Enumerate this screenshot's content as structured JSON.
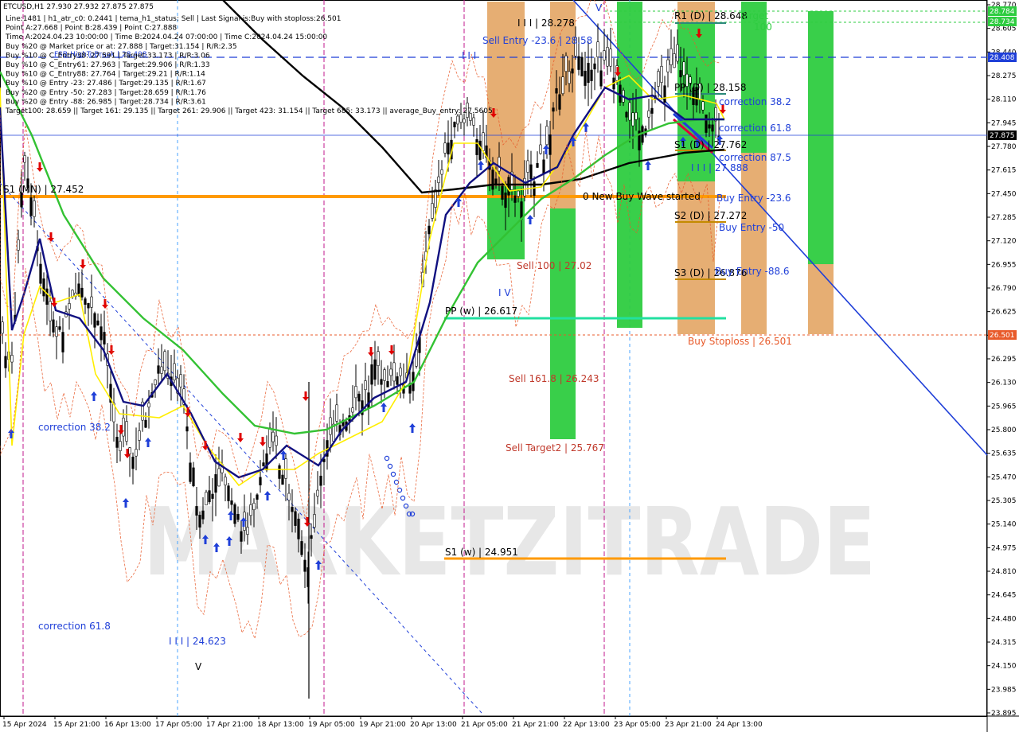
{
  "header": {
    "symbol_line": "ETCUSD,H1  27.930 27.932 27.875 27.875",
    "info_lines": [
      "Line:1481 | h1_atr_c0: 0.2441 | tema_h1_status: Sell | Last Signal is:Buy with stoploss:26.501",
      "Point A:27.668 | Point B:28.439 | Point C:27.888",
      "Time A:2024.04.23 10:00:00 | Time B:2024.04.24 07:00:00 | Time C:2024.04.24 15:00:00",
      "Buy %20 @ Market price or at: 27.888 | Target:31.154 | R/R:2.35",
      "Buy %10 @ C_Entry38: 27.591 | Target:33.173 | R/R:3.06",
      "Buy %10 @ C_Entry61: 27.963 | Target:29.906 | R/R:1.33",
      "Buy %10 @ C_Entry88: 27.764 | Target:29.21 | R/R:1.14",
      "Buy %10 @ Entry -23: 27.486 | Target:29.135 | R/R:1.67",
      "Buy %20 @ Entry -50: 27.283 | Target:28.659 | R/R:1.76",
      "Buy %20 @ Entry -88: 26.985 | Target:28.734 | R/R:3.61",
      "Target100: 28.659 || Target 161: 29.135 || Target 261: 29.906 || Target 423: 31.154 || Target 685: 33.173 || average_Buy_entry: 27.5605"
    ],
    "fsb_label": "FSB-HighToBreak | 28.408"
  },
  "price_axis": {
    "ticks": [
      "28.770",
      "28.605",
      "28.440",
      "28.275",
      "28.110",
      "27.945",
      "27.780",
      "27.615",
      "27.450",
      "27.285",
      "27.120",
      "26.955",
      "26.790",
      "26.625",
      "26.460",
      "26.295",
      "26.130",
      "25.965",
      "25.800",
      "25.635",
      "25.470",
      "25.305",
      "25.140",
      "24.975",
      "24.810",
      "24.645",
      "24.480",
      "24.315",
      "24.150",
      "23.985",
      "23.895"
    ],
    "tags": [
      {
        "text": "28.784",
        "color": "#2ecc40"
      },
      {
        "text": "28.734",
        "color": "#2ecc40"
      },
      {
        "text": "28.408",
        "color": "#1f3fd8"
      },
      {
        "text": "27.875",
        "color": "#000000"
      },
      {
        "text": "26.501",
        "color": "#e85a2a"
      }
    ]
  },
  "time_axis": {
    "labels": [
      "15 Apr 2024",
      "15 Apr 21:00",
      "16 Apr 13:00",
      "17 Apr 05:00",
      "17 Apr 21:00",
      "18 Apr 13:00",
      "19 Apr 05:00",
      "19 Apr 21:00",
      "20 Apr 13:00",
      "21 Apr 05:00",
      "21 Apr 21:00",
      "22 Apr 13:00",
      "23 Apr 05:00",
      "23 Apr 21:00",
      "24 Apr 13:00"
    ]
  },
  "annotations": {
    "III_28278": "I I I | 28.278",
    "sell_entry": "Sell Entry -23.6 | 28.58",
    "III_top": "I I I",
    "V_top": "V",
    "r1": "R1 (D) | 28.648",
    "target_label": "Target",
    "target_100": "100",
    "pp_d": "PP (D) | 28.158",
    "corr_382_right": "correction 38.2",
    "corr_618_right": "correction 61.8",
    "s1_d": "S1 (D) | 27.762",
    "corr_875": "correction 87.5",
    "III_27888": "I I I | 27.888",
    "s1_left": "S1 (MN) | 27.452",
    "new_wave": "0 New Buy Wave started",
    "buy_entry_236": "Buy Entry -23.6",
    "s2_d": "S2 (D) | 27.272",
    "buy_entry_50": "Buy Entry -50",
    "sell_100": "Sell 100 | 27.02",
    "s3_d": "S3 (D) | 26.876",
    "buy_entry_886": "Buy Entry -88.6",
    "IV_label": "I V",
    "pp_w": "PP (w) | 26.617",
    "buy_stoploss": "Buy Stoploss | 26.501",
    "sell_1618": "Sell 161.8 | 26.243",
    "corr_382_left": "correction 38.2",
    "sell_target2": "Sell Target2 | 25.767",
    "s1_w": "S1 (w) | 24.951",
    "corr_618_left": "correction 61.8",
    "III_24623": "I I I | 24.623",
    "V_bottom": "V"
  },
  "watermark": "MARKETZITRADE",
  "colors": {
    "bull_green": "#2ecc40",
    "bear_orange": "#e2a05a",
    "level_orange": "#ff9a00",
    "pp_w_green": "#22e0a0",
    "blue_trend": "#1f3fd8",
    "stoploss_red": "#e85a2a",
    "magenta_vline": "#c0188c",
    "ma_black": "#000000",
    "ma_green": "#33c233",
    "ma_yellow": "#ffee00",
    "ma_navy": "#101080"
  },
  "chart_data": {
    "type": "line",
    "title": "ETCUSD,H1",
    "timeframe": "H1",
    "ylim": [
      23.895,
      28.784
    ],
    "last_price": 27.875,
    "x": [
      "15 Apr 2024",
      "15 Apr 21:00",
      "16 Apr 13:00",
      "17 Apr 05:00",
      "17 Apr 21:00",
      "18 Apr 13:00",
      "19 Apr 05:00",
      "19 Apr 21:00",
      "20 Apr 13:00",
      "21 Apr 05:00",
      "21 Apr 21:00",
      "22 Apr 13:00",
      "23 Apr 05:00",
      "23 Apr 21:00",
      "24 Apr 13:00"
    ],
    "series": [
      {
        "values": [
          26.0,
          26.6,
          26.3,
          26.1,
          25.5,
          25.5,
          25.2,
          26.2,
          26.4,
          28.0,
          27.6,
          28.2,
          28.0,
          28.3,
          27.88
        ]
      },
      {
        "values": [
          26.5,
          26.2,
          26.0,
          25.9,
          25.7,
          25.6,
          25.5,
          25.9,
          26.3,
          27.5,
          27.6,
          28.0,
          27.95,
          28.1,
          27.95
        ]
      },
      {
        "values": [
          26.3,
          26.4,
          25.9,
          25.85,
          25.6,
          25.5,
          25.6,
          25.8,
          26.1,
          27.7,
          27.7,
          28.2,
          28.1,
          28.2,
          28.0
        ]
      },
      {
        "values": [
          27.9,
          27.0,
          26.5,
          26.2,
          25.9,
          25.8,
          25.9,
          26.1,
          26.3,
          26.9,
          27.3,
          27.8,
          27.9,
          28.0,
          28.0
        ]
      },
      {
        "values": [
          28.4,
          28.2,
          28.0,
          27.9,
          27.8,
          27.7,
          27.6,
          27.5,
          27.48,
          27.5,
          27.55,
          27.6,
          27.67,
          27.72,
          27.76
        ]
      }
    ],
    "levels": [
      {
        "label": "R1 (D)",
        "value": 28.648
      },
      {
        "label": "PP (D)",
        "value": 28.158
      },
      {
        "label": "S1 (D)",
        "value": 27.762
      },
      {
        "label": "S1 (MN)",
        "value": 27.452
      },
      {
        "label": "S2 (D)",
        "value": 27.272
      },
      {
        "label": "S3 (D)",
        "value": 26.876
      },
      {
        "label": "PP (w)",
        "value": 26.617
      },
      {
        "label": "Buy Stoploss",
        "value": 26.501
      },
      {
        "label": "S1 (w)",
        "value": 24.951
      },
      {
        "label": "FSB-HighToBreak",
        "value": 28.408
      }
    ],
    "grid": false,
    "legend": "none"
  }
}
